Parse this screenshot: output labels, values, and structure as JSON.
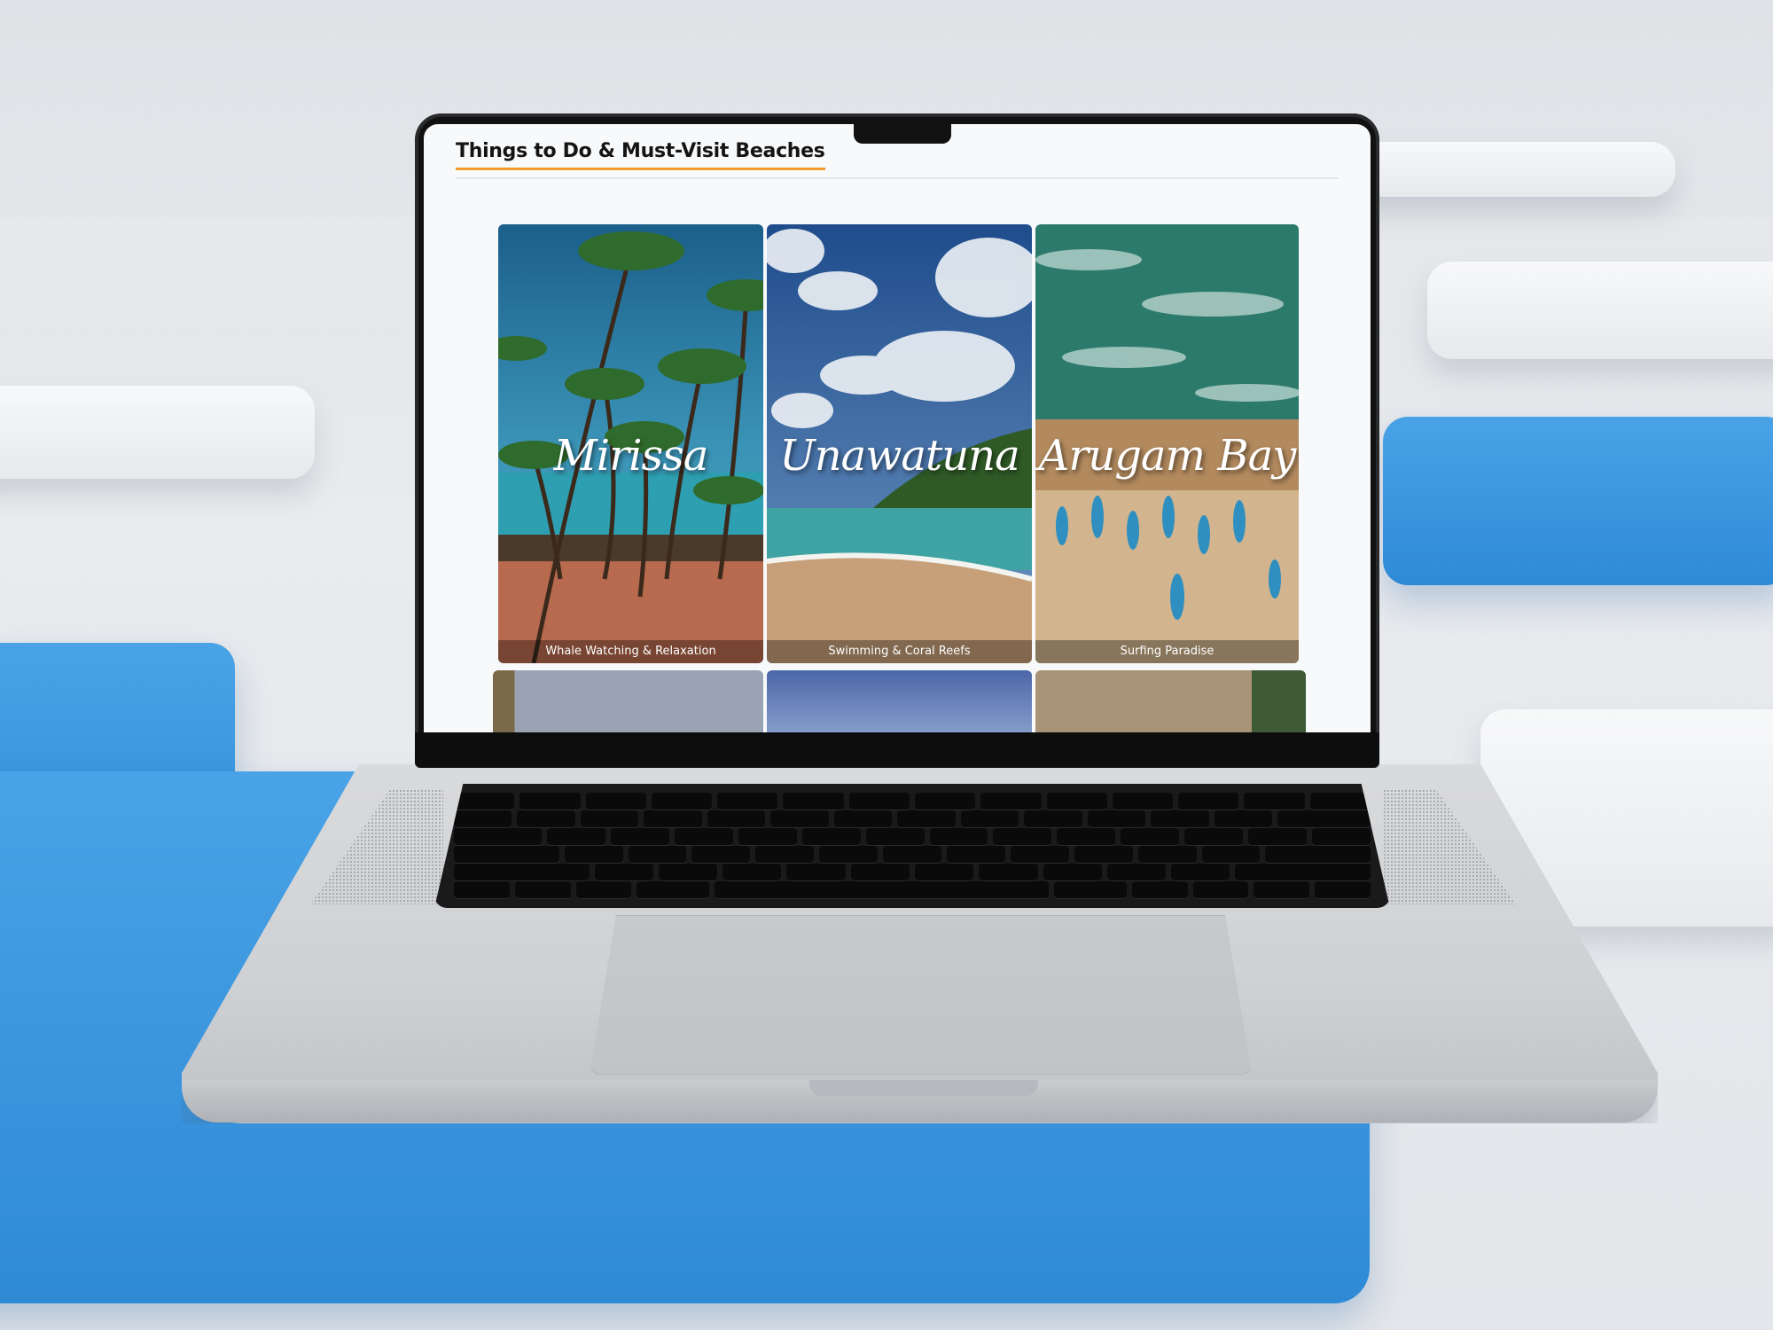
{
  "page": {
    "title": "Things to Do & Must-Visit Beaches"
  },
  "beaches": [
    {
      "name": "Mirissa",
      "activity": "Whale Watching & Relaxation"
    },
    {
      "name": "Unawatuna",
      "activity": "Swimming & Coral Reefs"
    },
    {
      "name": "Arugam Bay",
      "activity": "Surfing Paradise"
    }
  ],
  "colors": {
    "accent_underline": "#f39c2e",
    "background_blue": "#3b96dd"
  }
}
